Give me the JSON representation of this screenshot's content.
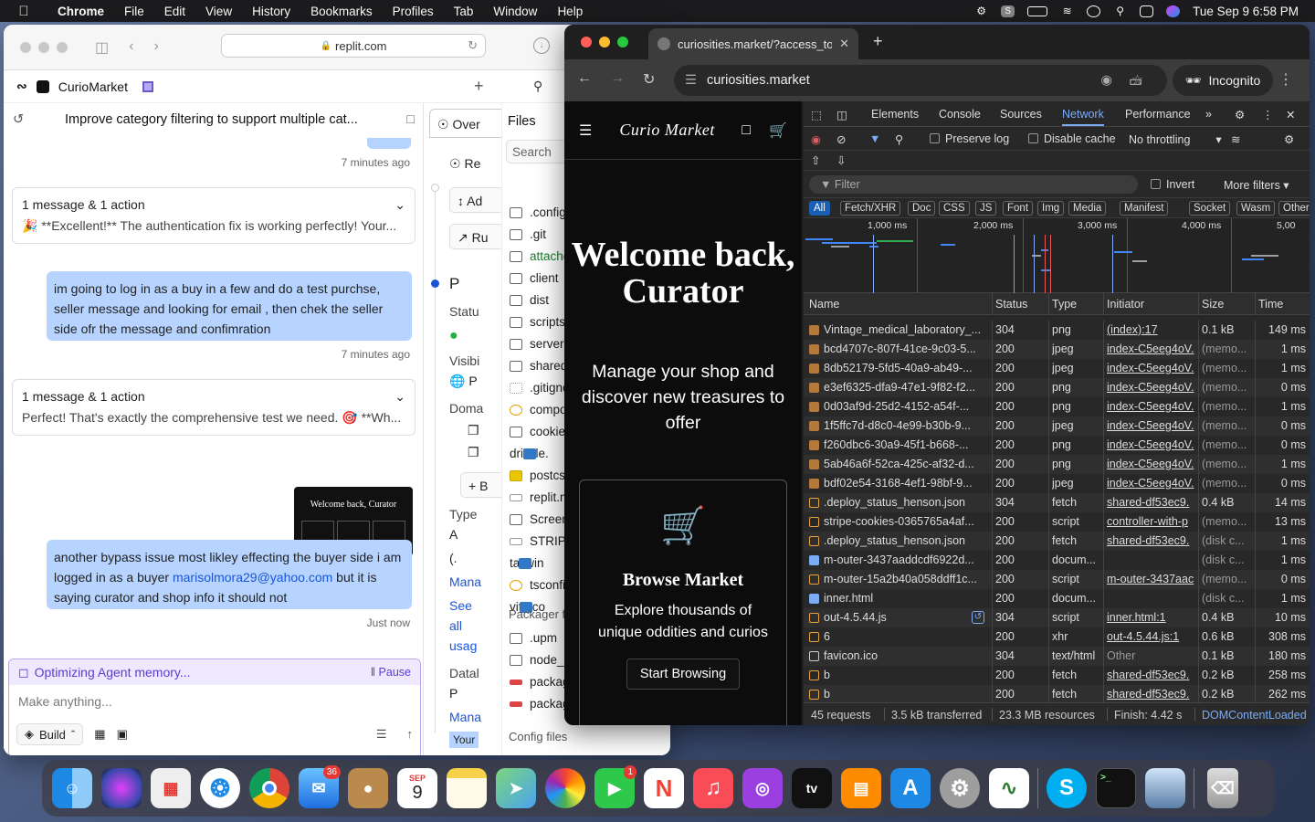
{
  "menubar": {
    "app": "Chrome",
    "items": [
      "File",
      "Edit",
      "View",
      "History",
      "Bookmarks",
      "Profiles",
      "Tab",
      "Window",
      "Help"
    ],
    "clock": "Tue Sep 9  6:58 PM"
  },
  "replit": {
    "url": "replit.com",
    "project": "CurioMarket",
    "chat_title": "Improve category filtering to support multiple cat...",
    "ts1": "7 minutes ago",
    "card1": {
      "head": "1 message & 1 action",
      "body": "🎉 **Excellent!** The authentication fix is working perfectly! Your..."
    },
    "bubble1": "im going to log in as a buy in a few and do a test purchse, seller message and looking for email , then chek the seller side ofr the message and confimration",
    "ts2": "7 minutes ago",
    "card2": {
      "head": "1 message & 1 action",
      "body": "Perfect! That's exactly the comprehensive test we need. 🎯 **Wh..."
    },
    "thumb_text": "Welcome back, Curator",
    "bubble2_pre": "another bypass issue most likley effecting the buyer side i am logged in as a buyer ",
    "bubble2_email": "marisolmora29@yahoo.com",
    "bubble2_post": " but it is saying curator and shop info it should not",
    "ts3": "Just now",
    "agent_status": "Optimizing Agent memory...",
    "pause": "Pause",
    "input_placeholder": "Make anything...",
    "build": "Build",
    "mid": {
      "tab": "Over",
      "items": [
        "Re",
        "Ad",
        "Ru"
      ],
      "p": "P",
      "status": "Statu",
      "visib": "Visibi",
      "vis_p": "P",
      "domain": "Doma",
      "btn": "+ B",
      "type": "Type",
      "a": "A",
      "paren": "(.",
      "mana": "Mana",
      "see": "See",
      "all": "all",
      "usage": "usag",
      "datab": "Datal",
      "p2": "P",
      "mana2": "Mana",
      "your": "Your"
    },
    "files": {
      "header": "Files",
      "search": "Search",
      "list": [
        ".config",
        ".git",
        "attache",
        "client",
        "dist",
        "scripts",
        "server",
        "shared",
        ".gitigno",
        "compo",
        "cookies",
        "drizzle.",
        "postcss",
        "replit.m",
        "Screen",
        "STRIPE",
        "tailwin",
        "tsconfi",
        "vite.co"
      ],
      "packager": "Packager file",
      "pk_list": [
        ".upm",
        "node_",
        "packag",
        "packag"
      ],
      "config": "Config files"
    }
  },
  "chrome": {
    "tab_title": "curiosities.market/?access_to",
    "url": "curiosities.market",
    "incognito": "Incognito"
  },
  "page": {
    "brand": "Curio Market",
    "welcome": "Welcome back, Curator",
    "sub": "Manage your shop and discover new treasures to offer",
    "card_title": "Browse Market",
    "card_body": "Explore thousands of unique oddities and curios",
    "start": "Start Browsing"
  },
  "devtools": {
    "tabs": [
      "Elements",
      "Console",
      "Sources",
      "Network",
      "Performance"
    ],
    "preserve": "Preserve log",
    "disable": "Disable cache",
    "throttle": "No throttling",
    "filter": "Filter",
    "invert": "Invert",
    "more": "More filters",
    "types": [
      "All",
      "Fetch/XHR",
      "Doc",
      "CSS",
      "JS",
      "Font",
      "Img",
      "Media",
      "Manifest",
      "Socket",
      "Wasm",
      "Other"
    ],
    "timeline": [
      "1,000 ms",
      "2,000 ms",
      "3,000 ms",
      "4,000 ms",
      "5,00"
    ],
    "cols": [
      "Name",
      "Status",
      "Type",
      "Initiator",
      "Size",
      "Time"
    ],
    "rows": [
      {
        "name": "Vintage_medical_laboratory_...",
        "status": "304",
        "type": "png",
        "init": "(index):17",
        "size": "0.1 kB",
        "time": "149 ms",
        "ic": "img"
      },
      {
        "name": "bcd4707c-807f-41ce-9c03-5...",
        "status": "200",
        "type": "jpeg",
        "init": "index-C5eeg4oV.",
        "size": "(memo...",
        "time": "1 ms",
        "ic": "img"
      },
      {
        "name": "8db52179-5fd5-40a9-ab49-...",
        "status": "200",
        "type": "jpeg",
        "init": "index-C5eeg4oV.",
        "size": "(memo...",
        "time": "1 ms",
        "ic": "img"
      },
      {
        "name": "e3ef6325-dfa9-47e1-9f82-f2...",
        "status": "200",
        "type": "png",
        "init": "index-C5eeg4oV.",
        "size": "(memo...",
        "time": "0 ms",
        "ic": "img"
      },
      {
        "name": "0d03af9d-25d2-4152-a54f-...",
        "status": "200",
        "type": "png",
        "init": "index-C5eeg4oV.",
        "size": "(memo...",
        "time": "1 ms",
        "ic": "img"
      },
      {
        "name": "1f5ffc7d-d8c0-4e99-b30b-9...",
        "status": "200",
        "type": "jpeg",
        "init": "index-C5eeg4oV.",
        "size": "(memo...",
        "time": "0 ms",
        "ic": "img"
      },
      {
        "name": "f260dbc6-30a9-45f1-b668-...",
        "status": "200",
        "type": "png",
        "init": "index-C5eeg4oV.",
        "size": "(memo...",
        "time": "0 ms",
        "ic": "img"
      },
      {
        "name": "5ab46a6f-52ca-425c-af32-d...",
        "status": "200",
        "type": "png",
        "init": "index-C5eeg4oV.",
        "size": "(memo...",
        "time": "1 ms",
        "ic": "img"
      },
      {
        "name": "bdf02e54-3168-4ef1-98bf-9...",
        "status": "200",
        "type": "jpeg",
        "init": "index-C5eeg4oV.",
        "size": "(memo...",
        "time": "0 ms",
        "ic": "img"
      },
      {
        "name": ".deploy_status_henson.json",
        "status": "304",
        "type": "fetch",
        "init": "shared-df53ec9.",
        "size": "0.4 kB",
        "time": "14 ms",
        "ic": "fetch"
      },
      {
        "name": "stripe-cookies-0365765a4af...",
        "status": "200",
        "type": "script",
        "init": "controller-with-p",
        "size": "(memo...",
        "time": "13 ms",
        "ic": "fetch"
      },
      {
        "name": ".deploy_status_henson.json",
        "status": "200",
        "type": "fetch",
        "init": "shared-df53ec9.",
        "size": "(disk c...",
        "time": "1 ms",
        "ic": "fetch"
      },
      {
        "name": "m-outer-3437aaddcdf6922d...",
        "status": "200",
        "type": "docum...",
        "init": "",
        "size": "(disk c...",
        "time": "1 ms",
        "ic": "doc"
      },
      {
        "name": "m-outer-15a2b40a058ddff1c...",
        "status": "200",
        "type": "script",
        "init": "m-outer-3437aac",
        "size": "(memo...",
        "time": "0 ms",
        "ic": "fetch"
      },
      {
        "name": "inner.html",
        "status": "200",
        "type": "docum...",
        "init": "",
        "size": "(disk c...",
        "time": "1 ms",
        "ic": "doc"
      },
      {
        "name": "out-4.5.44.js",
        "status": "304",
        "type": "script",
        "init": "inner.html:1",
        "size": "0.4 kB",
        "time": "10 ms",
        "ic": "fetch"
      },
      {
        "name": "6",
        "status": "200",
        "type": "xhr",
        "init": "out-4.5.44.js:1",
        "size": "0.6 kB",
        "time": "308 ms",
        "ic": "fetch"
      },
      {
        "name": "favicon.ico",
        "status": "304",
        "type": "text/html",
        "init": "Other",
        "size": "0.1 kB",
        "time": "180 ms",
        "ic": "blank"
      },
      {
        "name": "b",
        "status": "200",
        "type": "fetch",
        "init": "shared-df53ec9.",
        "size": "0.2 kB",
        "time": "258 ms",
        "ic": "fetch"
      },
      {
        "name": "b",
        "status": "200",
        "type": "fetch",
        "init": "shared-df53ec9.",
        "size": "0.2 kB",
        "time": "262 ms",
        "ic": "fetch"
      }
    ],
    "status": {
      "requests": "45 requests",
      "transferred": "3.5 kB transferred",
      "resources": "23.3 MB resources",
      "finish": "Finish: 4.42 s",
      "dcl": "DOMContentLoaded"
    }
  },
  "dock": {
    "mail_badge": "36",
    "facetime_badge": "1",
    "cal_month": "SEP",
    "cal_day": "9"
  }
}
